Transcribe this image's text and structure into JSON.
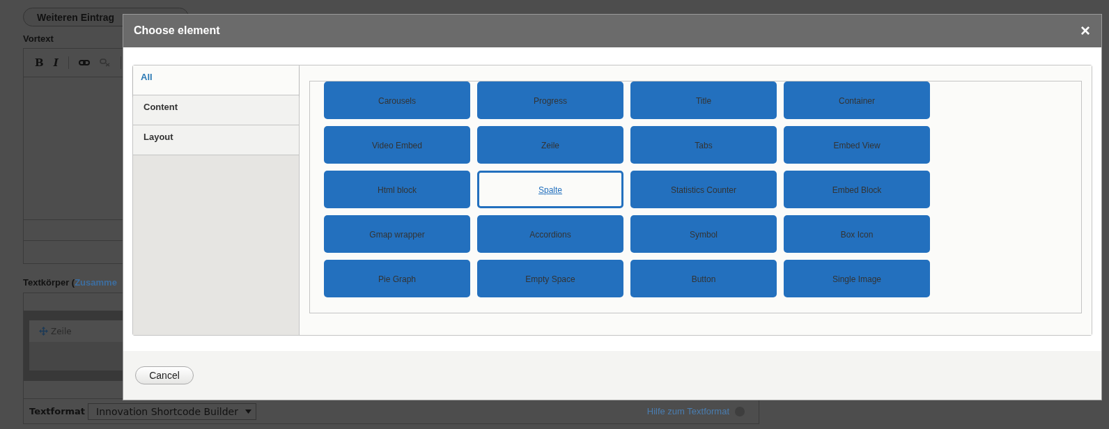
{
  "background_page": {
    "add_button": "Weiteren Eintrag",
    "vortext_label": "Vortext",
    "toolbar_buttons": [
      "B",
      "I"
    ],
    "body_label": "Textkörper (",
    "body_label_link": "Zusamme",
    "row_block": "Zeile",
    "format_label": "Textformat",
    "format_select": "Innovation Shortcode Builder",
    "format_help": "Hilfe zum Textformat"
  },
  "dialog": {
    "title": "Choose element",
    "close": "×",
    "tabs": [
      {
        "label": "All",
        "selected": true
      },
      {
        "label": "Content",
        "selected": false
      },
      {
        "label": "Layout",
        "selected": false
      }
    ],
    "elements": [
      {
        "label": "Carousels",
        "selected": false
      },
      {
        "label": "Progress",
        "selected": false
      },
      {
        "label": "Title",
        "selected": false
      },
      {
        "label": "Container",
        "selected": false
      },
      {
        "label": "Video Embed",
        "selected": false
      },
      {
        "label": "Zeile",
        "selected": false
      },
      {
        "label": "Tabs",
        "selected": false
      },
      {
        "label": "Embed View",
        "selected": false
      },
      {
        "label": "Html block",
        "selected": false
      },
      {
        "label": "Spalte",
        "selected": true
      },
      {
        "label": "Statistics Counter",
        "selected": false
      },
      {
        "label": "Embed Block",
        "selected": false
      },
      {
        "label": "Gmap wrapper",
        "selected": false
      },
      {
        "label": "Accordions",
        "selected": false
      },
      {
        "label": "Symbol",
        "selected": false
      },
      {
        "label": "Box Icon",
        "selected": false
      },
      {
        "label": "Pie Graph",
        "selected": false
      },
      {
        "label": "Empty Space",
        "selected": false
      },
      {
        "label": "Button",
        "selected": false
      },
      {
        "label": "Single Image",
        "selected": false
      }
    ],
    "cancel": "Cancel"
  }
}
